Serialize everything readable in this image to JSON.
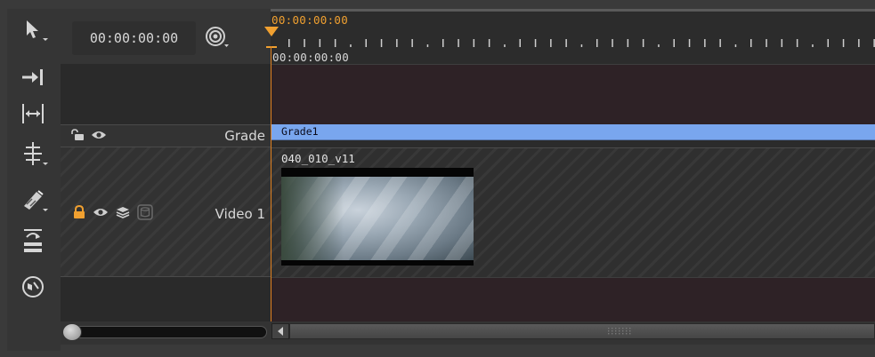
{
  "toolbar": {
    "tools": [
      {
        "name": "select-tool",
        "icon": "arrow-pointer-icon"
      },
      {
        "name": "track-select-tool",
        "icon": "arrow-to-bar-icon"
      },
      {
        "name": "slip-tool",
        "icon": "bracket-arrows-icon"
      },
      {
        "name": "ripple-tool",
        "icon": "ripple-bars-icon"
      },
      {
        "name": "razor-tool",
        "icon": "razor-icon"
      },
      {
        "name": "retime-tool",
        "icon": "retime-icon"
      },
      {
        "name": "audio-tool",
        "icon": "speaker-circle-icon"
      }
    ]
  },
  "header": {
    "timecode": "00:00:00:00",
    "snap_icon": "snap-target-icon"
  },
  "ruler": {
    "playhead_timecode": "00:00:00:00",
    "in_timecode": "00:00:00:00"
  },
  "tracks": {
    "grade": {
      "name": "Grade",
      "clip_label": "Grade1",
      "color": "#79a6ee"
    },
    "video": {
      "name": "Video 1",
      "clip_label": "040_010_v11",
      "locked_color": "#f0a030"
    }
  },
  "colors": {
    "playhead": "#e08020",
    "empty_track": "#2e2226"
  }
}
